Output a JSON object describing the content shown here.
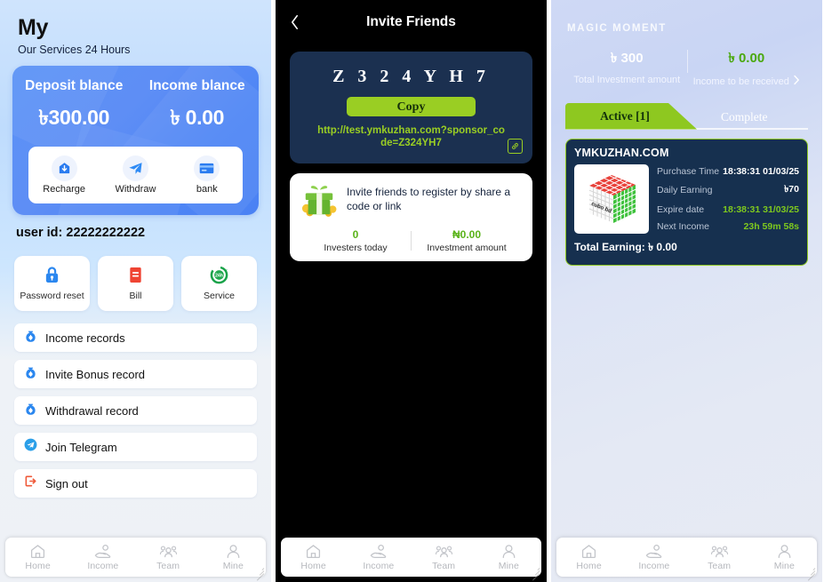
{
  "panel1": {
    "header": {
      "title": "My",
      "subtitle": "Our Services 24 Hours"
    },
    "balance_card": {
      "deposit_label": "Deposit blance",
      "deposit_value": "৳300.00",
      "income_label": "Income blance",
      "income_value": "৳ 0.00",
      "actions": [
        {
          "label": "Recharge",
          "icon": "recharge-icon"
        },
        {
          "label": "Withdraw",
          "icon": "withdraw-icon"
        },
        {
          "label": "bank",
          "icon": "bank-card-icon"
        }
      ]
    },
    "user_id": "user id: 22222222222",
    "quick_tiles": [
      {
        "label": "Password reset",
        "icon": "lock-icon"
      },
      {
        "label": "Bill",
        "icon": "bill-icon"
      },
      {
        "label": "Service",
        "icon": "service-24h-icon"
      }
    ],
    "rows": [
      {
        "label": "Income records",
        "icon": "money-bag-icon"
      },
      {
        "label": "Invite Bonus record",
        "icon": "money-bag-icon"
      },
      {
        "label": "Withdrawal record",
        "icon": "money-bag-icon"
      },
      {
        "label": "Join Telegram",
        "icon": "telegram-icon"
      },
      {
        "label": "Sign out",
        "icon": "sign-out-icon"
      }
    ]
  },
  "panel2": {
    "nav": {
      "title": "Invite Friends",
      "back_icon": "chevron-left-icon"
    },
    "code_card": {
      "code": "Z 3 2 4 Y H 7",
      "copy_label": "Copy",
      "link": "http://test.ymkuzhan.com?sponsor_code=Z324YH7",
      "link_icon": "link-icon"
    },
    "invite_card": {
      "gift_icon": "gift-box-icon",
      "text": "Invite friends to register by share a code or link",
      "stats": [
        {
          "value": "0",
          "label": "Investers today"
        },
        {
          "value": "₦0.00",
          "label": "Investment amount"
        }
      ]
    }
  },
  "panel3": {
    "magic": {
      "title": "MAGIC MOMENT",
      "total_investment_value": "৳ 300",
      "total_investment_label": "Total Investment amount",
      "income_value": "৳ 0.00",
      "income_label": "Income to be received",
      "chevron_icon": "chevron-right-icon"
    },
    "tabs": [
      {
        "label": "Active [1]",
        "active": true
      },
      {
        "label": "Complete",
        "active": false
      }
    ],
    "product": {
      "title": "YMKUZHAN.COM",
      "thumb_icon": "rubiks-cube-image",
      "specs": [
        {
          "key": "Purchase Time",
          "value": "18:38:31 01/03/25",
          "color": "white"
        },
        {
          "key": "Daily Earning",
          "value": "৳70",
          "color": "white"
        },
        {
          "key": "Expire date",
          "value": "18:38:31 31/03/25",
          "color": "green"
        },
        {
          "key": "Next Income",
          "value": "23h 59m 58s",
          "color": "green"
        }
      ],
      "total_earning": "Total Earning: ৳ 0.00"
    }
  },
  "tabbar": [
    {
      "label": "Home",
      "icon": "home-icon"
    },
    {
      "label": "Income",
      "icon": "income-hand-icon"
    },
    {
      "label": "Team",
      "icon": "team-icon"
    },
    {
      "label": "Mine",
      "icon": "person-icon"
    }
  ],
  "colors": {
    "accent_green": "#9ace23",
    "card_blue": "#5b93f6",
    "dark_navy": "#16304f",
    "black": "#000000"
  }
}
